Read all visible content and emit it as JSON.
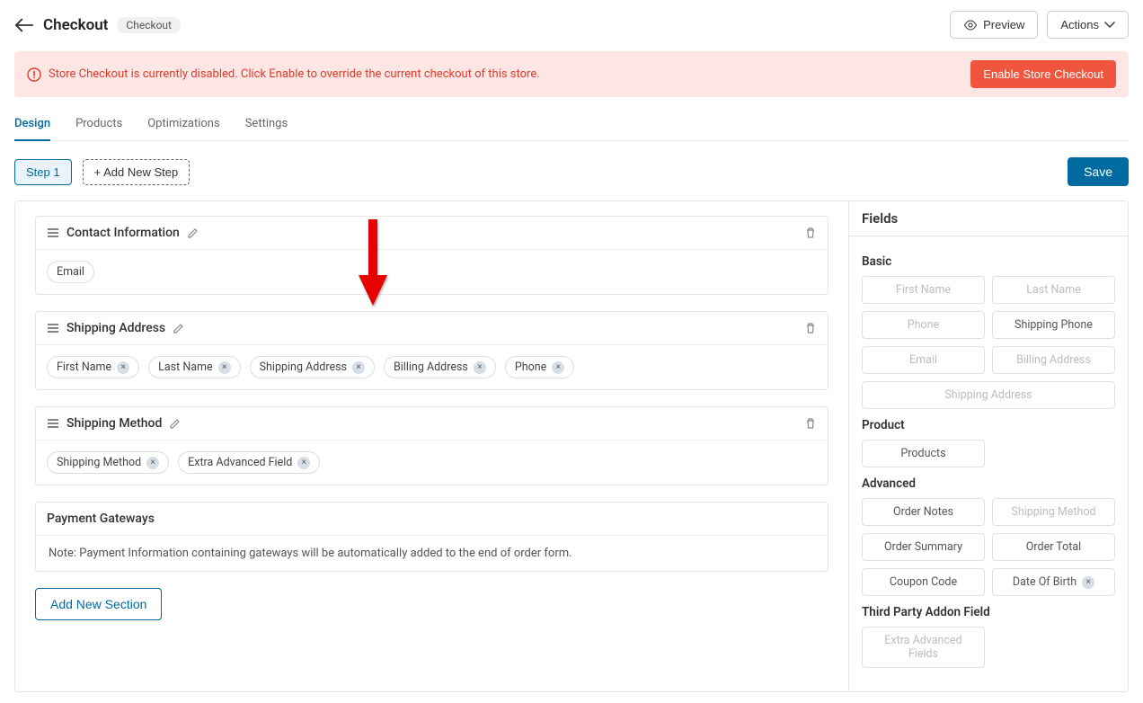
{
  "header": {
    "title": "Checkout",
    "badge": "Checkout",
    "preview": "Preview",
    "actions": "Actions"
  },
  "alert": {
    "text": "Store Checkout is currently disabled. Click Enable to override the current checkout of this store.",
    "button": "Enable Store Checkout"
  },
  "tabs": {
    "design": "Design",
    "products": "Products",
    "optimizations": "Optimizations",
    "settings": "Settings"
  },
  "steps": {
    "step1": "Step 1",
    "add": "+ Add New Step",
    "save": "Save"
  },
  "sections": {
    "contact": {
      "title": "Contact Information",
      "fields": {
        "email": "Email"
      }
    },
    "shipping_address": {
      "title": "Shipping Address",
      "fields": {
        "first_name": "First Name",
        "last_name": "Last Name",
        "shipping_address": "Shipping Address",
        "billing_address": "Billing Address",
        "phone": "Phone"
      }
    },
    "shipping_method": {
      "title": "Shipping Method",
      "fields": {
        "shipping_method": "Shipping Method",
        "extra_adv": "Extra Advanced Field"
      }
    },
    "payment": {
      "title": "Payment Gateways",
      "note": "Note: Payment Information containing gateways will be automatically added to the end of order form."
    },
    "add_new": "Add New Section"
  },
  "sidebar": {
    "title": "Fields",
    "groups": {
      "basic": {
        "title": "Basic",
        "fields": {
          "first_name": "First Name",
          "last_name": "Last Name",
          "phone": "Phone",
          "shipping_phone": "Shipping Phone",
          "email": "Email",
          "billing_address": "Billing Address",
          "shipping_address": "Shipping Address"
        }
      },
      "product": {
        "title": "Product",
        "fields": {
          "products": "Products"
        }
      },
      "advanced": {
        "title": "Advanced",
        "fields": {
          "order_notes": "Order Notes",
          "shipping_method": "Shipping Method",
          "order_summary": "Order Summary",
          "order_total": "Order Total",
          "coupon_code": "Coupon Code",
          "date_of_birth": "Date Of Birth"
        }
      },
      "third_party": {
        "title": "Third Party Addon Field",
        "fields": {
          "extra": "Extra Advanced Fields"
        }
      }
    }
  },
  "colors": {
    "accent": "#006ba1",
    "danger": "#f0553d"
  }
}
